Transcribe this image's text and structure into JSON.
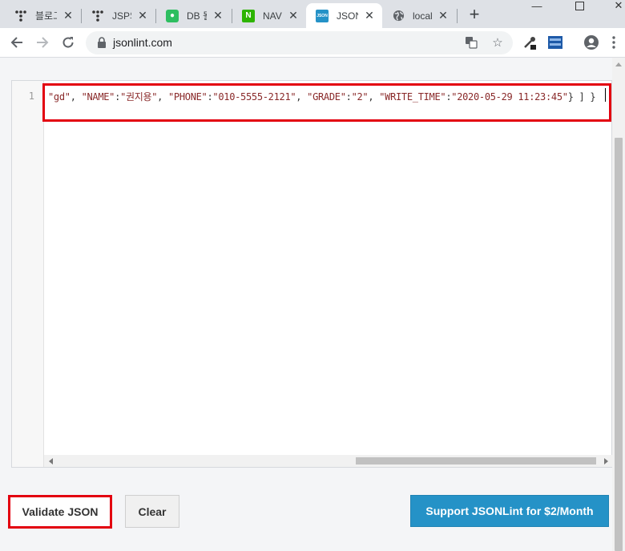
{
  "browser": {
    "tabs": [
      {
        "title": "블로그",
        "icon": "tistory-icon"
      },
      {
        "title": "JSP의",
        "icon": "tistory-icon"
      },
      {
        "title": "DB 될",
        "icon": "evernote-icon"
      },
      {
        "title": "NAVE",
        "icon": "naver-icon"
      },
      {
        "title": "JSON",
        "icon": "jsonlint-icon"
      },
      {
        "title": "localh",
        "icon": "globe-icon"
      }
    ],
    "new_tab_label": "+",
    "url": "jsonlint.com"
  },
  "editor": {
    "line_number": "1",
    "code": {
      "t1": "\"gd\"",
      "t2": ", ",
      "t3": "\"NAME\"",
      "t4": ":",
      "t5": "\"권지용\"",
      "t6": ", ",
      "t7": "\"PHONE\"",
      "t8": ":",
      "t9": "\"010-5555-2121\"",
      "t10": ", ",
      "t11": "\"GRADE\"",
      "t12": ":",
      "t13": "\"2\"",
      "t14": ", ",
      "t15": "\"WRITE_TIME\"",
      "t16": ":",
      "t17": "\"2020-05-29 11:23:45\"",
      "t18": "} ] }"
    }
  },
  "buttons": {
    "validate": "Validate JSON",
    "clear": "Clear",
    "support": "Support JSONLint for $2/Month"
  },
  "colors": {
    "highlight": "#e3000f",
    "support_button": "#2592c7",
    "code_string": "#8a2a2a"
  }
}
